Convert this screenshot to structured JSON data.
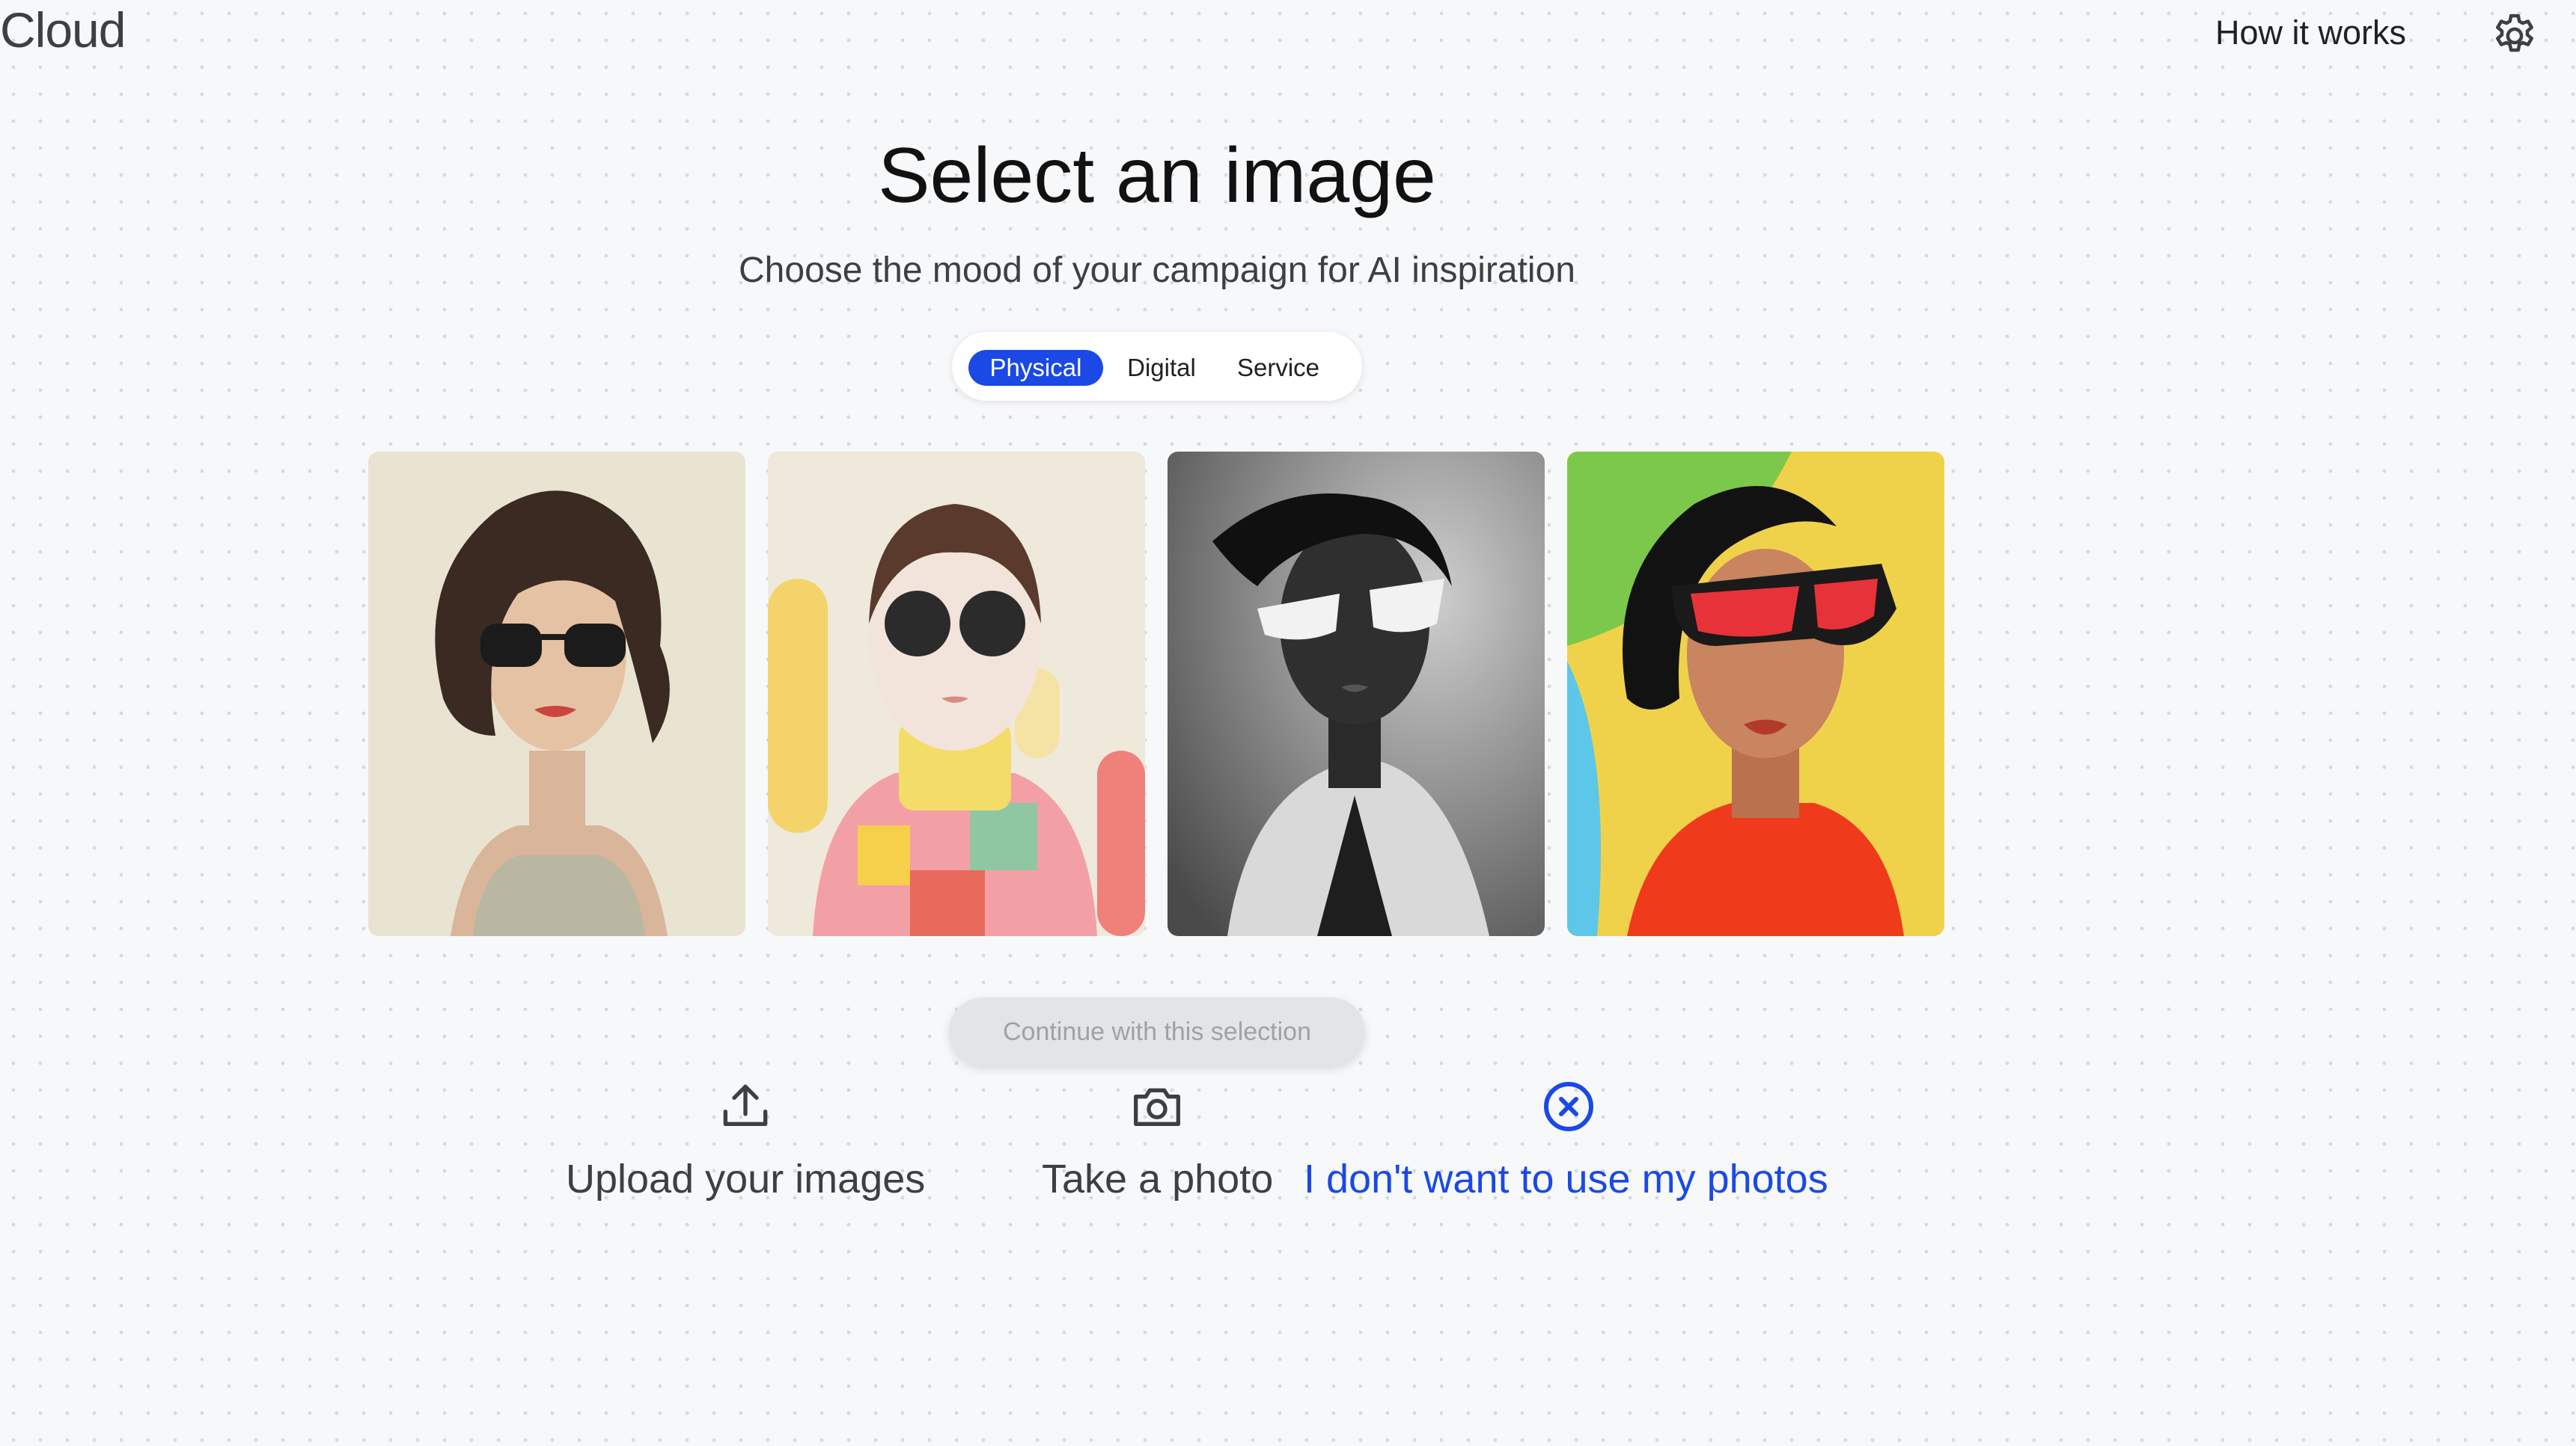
{
  "header": {
    "brand": "Cloud",
    "how_it_works": "How it works",
    "settings_icon": "gear-icon"
  },
  "main": {
    "title": "Select an image",
    "subtitle": "Choose the mood of your campaign for AI inspiration",
    "tabs": [
      {
        "label": "Physical",
        "selected": true
      },
      {
        "label": "Digital",
        "selected": false
      },
      {
        "label": "Service",
        "selected": false
      }
    ],
    "images": [
      {
        "subject": "illustrated woman with wavy bob and dark sunglasses"
      },
      {
        "subject": "3D character with round sunglasses and pastel patchwork sweater"
      },
      {
        "subject": "black and white portrait with white sunglasses and trench coat"
      },
      {
        "subject": "colorful portrait with red visor sunglasses and orange turtleneck"
      }
    ],
    "continue_label": "Continue with this selection",
    "actions": [
      {
        "label": "Upload your images",
        "icon": "upload-icon"
      },
      {
        "label": "Take a photo",
        "icon": "camera-icon"
      },
      {
        "label": "I don't want to use my photos",
        "icon": "close-circle-icon"
      }
    ]
  },
  "colors": {
    "accent": "#1a49e5",
    "background": "#f7f8fa",
    "disabled_button": "#e3e4e6"
  }
}
